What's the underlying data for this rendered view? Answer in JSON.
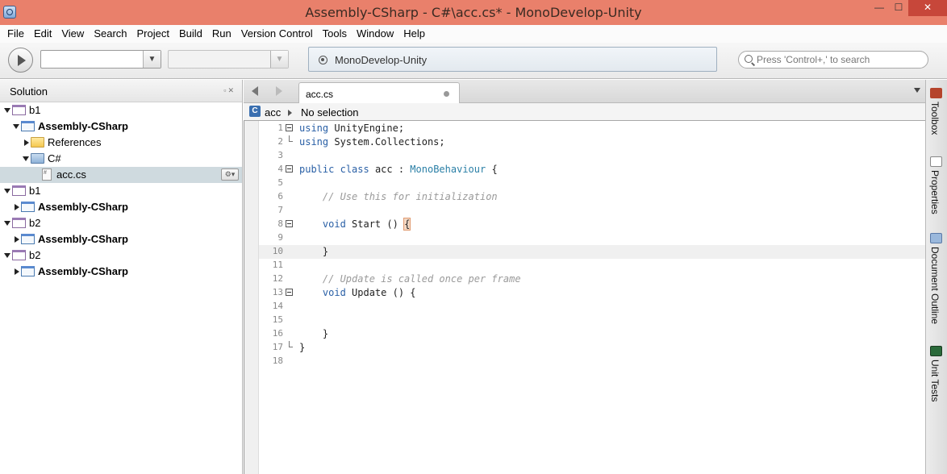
{
  "window": {
    "title": "Assembly-CSharp - C#\\acc.cs* - MonoDevelop-Unity",
    "minimize": "—",
    "maximize": "☐",
    "close": "✕"
  },
  "menu": [
    "File",
    "Edit",
    "View",
    "Search",
    "Project",
    "Build",
    "Run",
    "Version Control",
    "Tools",
    "Window",
    "Help"
  ],
  "toolbar": {
    "config_value": "",
    "platform_value": "",
    "status_text": "MonoDevelop-Unity",
    "search_placeholder": "Press 'Control+,' to search"
  },
  "solution_pad": {
    "title": "Solution",
    "controls": "▫✕",
    "tree": [
      {
        "label": "b1",
        "type": "solution",
        "level": 0,
        "expanded": true,
        "bold": false
      },
      {
        "label": "Assembly-CSharp",
        "type": "project",
        "level": 1,
        "expanded": true,
        "bold": true
      },
      {
        "label": "References",
        "type": "folder",
        "level": 2,
        "expanded": false,
        "bold": false
      },
      {
        "label": "C#",
        "type": "folder-blue",
        "level": 2,
        "expanded": true,
        "bold": false
      },
      {
        "label": "acc.cs",
        "type": "file",
        "level": 3,
        "selected": true,
        "bold": false
      },
      {
        "label": "b1",
        "type": "solution",
        "level": 0,
        "expanded": true,
        "bold": false
      },
      {
        "label": "Assembly-CSharp",
        "type": "project",
        "level": 1,
        "expanded": false,
        "bold": true
      },
      {
        "label": "b2",
        "type": "solution",
        "level": 0,
        "expanded": true,
        "bold": false
      },
      {
        "label": "Assembly-CSharp",
        "type": "project",
        "level": 1,
        "expanded": false,
        "bold": true
      },
      {
        "label": "b2",
        "type": "solution",
        "level": 0,
        "expanded": true,
        "bold": false
      },
      {
        "label": "Assembly-CSharp",
        "type": "project",
        "level": 1,
        "expanded": false,
        "bold": true
      }
    ]
  },
  "editor": {
    "tab_label": "acc.cs",
    "path_class_icon": "C",
    "path_class": "acc",
    "path_member": "No selection",
    "current_line": 10,
    "lines": [
      {
        "n": "1",
        "fold": "open",
        "tokens": [
          [
            "kw",
            "using"
          ],
          [
            "",
            " UnityEngine;"
          ]
        ]
      },
      {
        "n": "2",
        "fold": "end",
        "tokens": [
          [
            "kw",
            "using"
          ],
          [
            "",
            " System.Collections;"
          ]
        ]
      },
      {
        "n": "3",
        "fold": "",
        "tokens": []
      },
      {
        "n": "4",
        "fold": "open",
        "tokens": [
          [
            "kw",
            "public"
          ],
          [
            "",
            " "
          ],
          [
            "kw",
            "class"
          ],
          [
            "",
            " acc : "
          ],
          [
            "typ",
            "MonoBehaviour"
          ],
          [
            "",
            " {"
          ]
        ]
      },
      {
        "n": "5",
        "fold": "",
        "tokens": []
      },
      {
        "n": "6",
        "fold": "",
        "tokens": [
          [
            "",
            "    "
          ],
          [
            "cmt",
            "// Use this for initialization"
          ]
        ]
      },
      {
        "n": "7",
        "fold": "",
        "tokens": []
      },
      {
        "n": "8",
        "fold": "open",
        "tokens": [
          [
            "",
            "    "
          ],
          [
            "kw",
            "void"
          ],
          [
            "",
            " Start () "
          ],
          [
            "brace-hl",
            "{"
          ]
        ]
      },
      {
        "n": "9",
        "fold": "",
        "tokens": []
      },
      {
        "n": "10",
        "fold": "",
        "tokens": [
          [
            "",
            "    }"
          ]
        ]
      },
      {
        "n": "11",
        "fold": "",
        "tokens": []
      },
      {
        "n": "12",
        "fold": "",
        "tokens": [
          [
            "",
            "    "
          ],
          [
            "cmt",
            "// Update is called once per frame"
          ]
        ]
      },
      {
        "n": "13",
        "fold": "open",
        "tokens": [
          [
            "",
            "    "
          ],
          [
            "kw",
            "void"
          ],
          [
            "",
            " Update () {"
          ]
        ]
      },
      {
        "n": "14",
        "fold": "",
        "tokens": []
      },
      {
        "n": "15",
        "fold": "",
        "tokens": []
      },
      {
        "n": "16",
        "fold": "",
        "tokens": [
          [
            "",
            "    }"
          ]
        ]
      },
      {
        "n": "17",
        "fold": "end",
        "tokens": [
          [
            "",
            "}"
          ]
        ]
      },
      {
        "n": "18",
        "fold": "",
        "tokens": []
      }
    ]
  },
  "right_dock": [
    {
      "label": "Toolbox",
      "icon": "toolbox-icon"
    },
    {
      "label": "Properties",
      "icon": "properties-icon"
    },
    {
      "label": "Document Outline",
      "icon": "document-outline-icon"
    },
    {
      "label": "Unit Tests",
      "icon": "unit-tests-icon"
    }
  ]
}
